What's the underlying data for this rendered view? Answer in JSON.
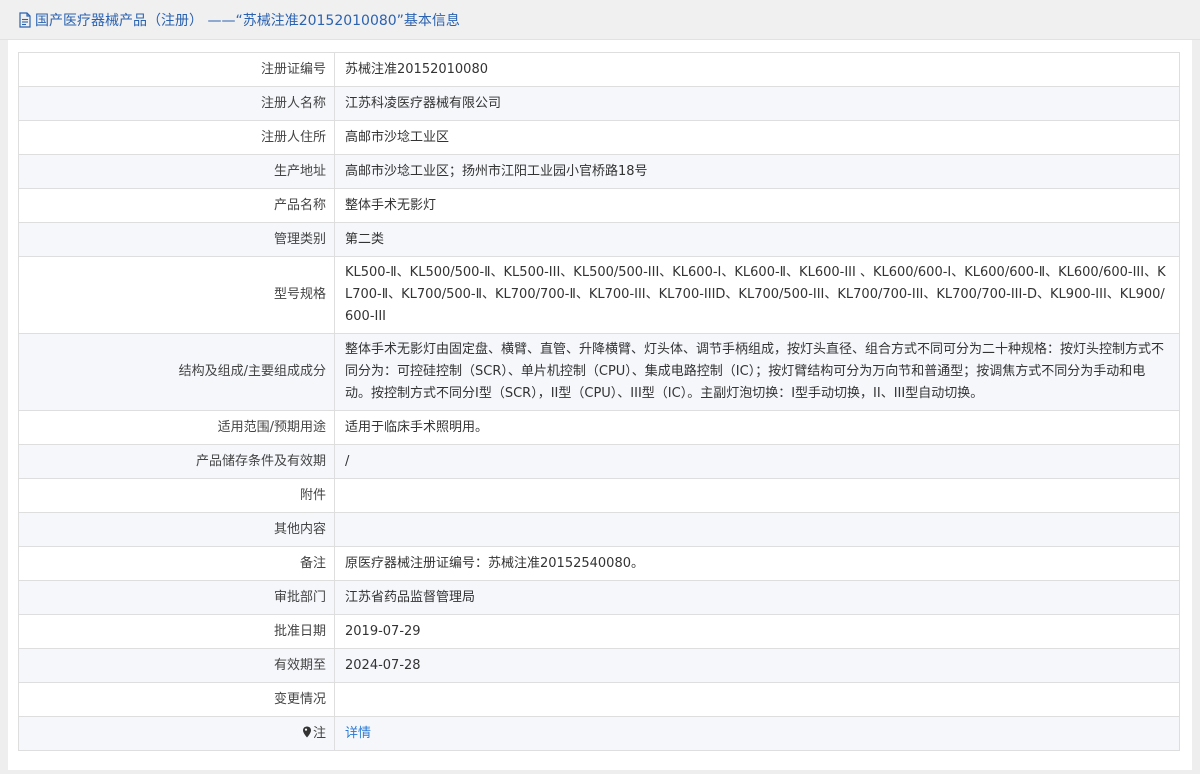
{
  "header": {
    "title": "国产医疗器械产品（注册） ——“苏械注准20152010080”基本信息"
  },
  "rows": [
    {
      "label": "注册证编号",
      "value": "苏械注准20152010080"
    },
    {
      "label": "注册人名称",
      "value": "江苏科凌医疗器械有限公司"
    },
    {
      "label": "注册人住所",
      "value": "高邮市沙埝工业区"
    },
    {
      "label": "生产地址",
      "value": "高邮市沙埝工业区；扬州市江阳工业园小官桥路18号"
    },
    {
      "label": "产品名称",
      "value": "整体手术无影灯"
    },
    {
      "label": "管理类别",
      "value": "第二类"
    },
    {
      "label": "型号规格",
      "value": "KL500-Ⅱ、KL500/500-Ⅱ、KL500-III、KL500/500-III、KL600-Ⅰ、KL600-Ⅱ、KL600-III 、KL600/600-I、KL600/600-Ⅱ、KL600/600-III、KL700-Ⅱ、KL700/500-Ⅱ、KL700/700-Ⅱ、KL700-III、KL700-IIID、KL700/500-III、KL700/700-III、KL700/700-III-D、KL900-III、KL900/600-III"
    },
    {
      "label": "结构及组成/主要组成成分",
      "value": "整体手术无影灯由固定盘、横臂、直管、升降横臂、灯头体、调节手柄组成，按灯头直径、组合方式不同可分为二十种规格：按灯头控制方式不同分为：可控硅控制（SCR）、单片机控制（CPU）、集成电路控制（IC）；按灯臂结构可分为万向节和普通型；按调焦方式不同分为手动和电动。按控制方式不同分I型（SCR），II型（CPU）、III型（IC）。主副灯泡切换：I型手动切换，II、III型自动切换。"
    },
    {
      "label": "适用范围/预期用途",
      "value": "适用于临床手术照明用。"
    },
    {
      "label": "产品储存条件及有效期",
      "value": "/"
    },
    {
      "label": "附件",
      "value": ""
    },
    {
      "label": "其他内容",
      "value": ""
    },
    {
      "label": "备注",
      "value": "原医疗器械注册证编号：苏械注准20152540080。"
    },
    {
      "label": "审批部门",
      "value": "江苏省药品监督管理局"
    },
    {
      "label": "批准日期",
      "value": "2019-07-29"
    },
    {
      "label": "有效期至",
      "value": "2024-07-28"
    },
    {
      "label": "变更情况",
      "value": ""
    }
  ],
  "note": {
    "label": "注",
    "link_text": "详情"
  }
}
